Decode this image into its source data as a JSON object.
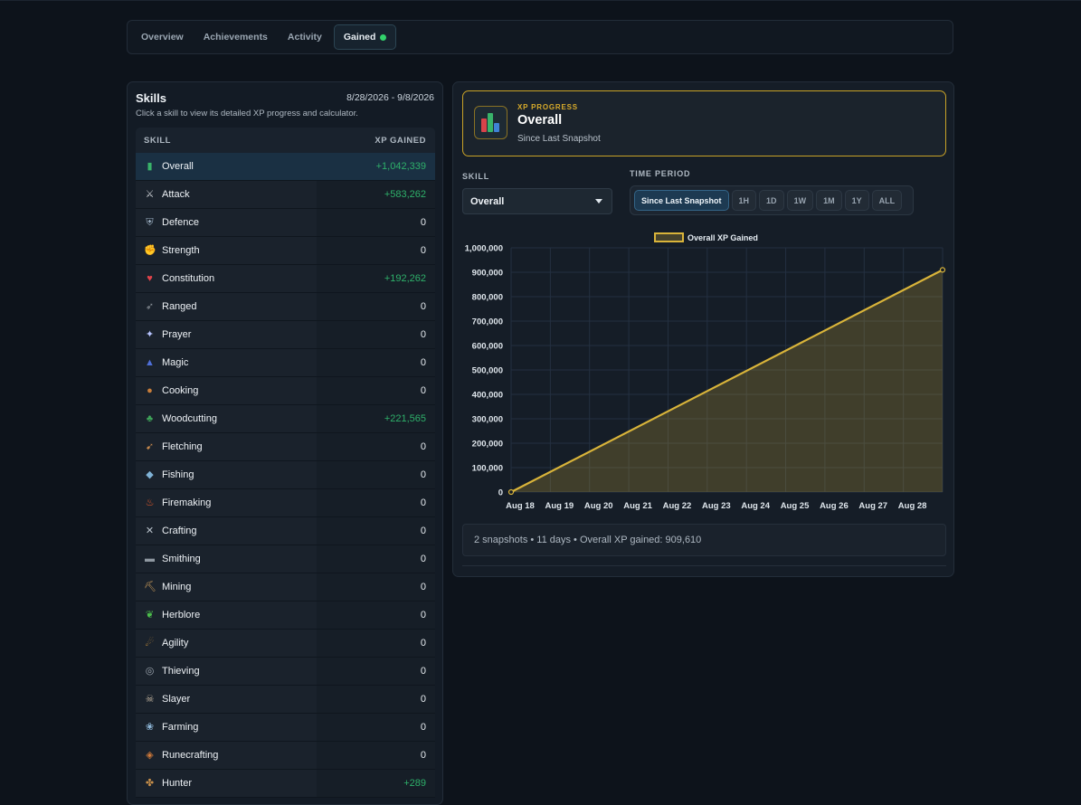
{
  "tabs": [
    {
      "label": "Overview"
    },
    {
      "label": "Achievements"
    },
    {
      "label": "Activity"
    },
    {
      "label": "Gained",
      "status_color": "#32d26b"
    }
  ],
  "skills_panel": {
    "title": "Skills",
    "date_range": "8/28/2026 - 9/8/2026",
    "subtitle": "Click a skill to view its detailed XP progress and calculator.",
    "col_skill": "SKILL",
    "col_xp": "XP GAINED",
    "rows": [
      {
        "name": "Overall",
        "xp": "+1,042,339",
        "icon": "bar-chart-icon"
      },
      {
        "name": "Attack",
        "xp": "+583,262",
        "icon": "sword-icon"
      },
      {
        "name": "Defence",
        "xp": "0",
        "icon": "shield-icon"
      },
      {
        "name": "Strength",
        "xp": "0",
        "icon": "fist-icon"
      },
      {
        "name": "Constitution",
        "xp": "+192,262",
        "icon": "heart-icon"
      },
      {
        "name": "Ranged",
        "xp": "0",
        "icon": "bow-icon"
      },
      {
        "name": "Prayer",
        "xp": "0",
        "icon": "star-icon"
      },
      {
        "name": "Magic",
        "xp": "0",
        "icon": "wizard-hat-icon"
      },
      {
        "name": "Cooking",
        "xp": "0",
        "icon": "pot-icon"
      },
      {
        "name": "Woodcutting",
        "xp": "+221,565",
        "icon": "tree-icon"
      },
      {
        "name": "Fletching",
        "xp": "0",
        "icon": "arrow-icon"
      },
      {
        "name": "Fishing",
        "xp": "0",
        "icon": "fish-icon"
      },
      {
        "name": "Firemaking",
        "xp": "0",
        "icon": "fire-icon"
      },
      {
        "name": "Crafting",
        "xp": "0",
        "icon": "tools-icon"
      },
      {
        "name": "Smithing",
        "xp": "0",
        "icon": "anvil-icon"
      },
      {
        "name": "Mining",
        "xp": "0",
        "icon": "pickaxe-icon"
      },
      {
        "name": "Herblore",
        "xp": "0",
        "icon": "herb-icon"
      },
      {
        "name": "Agility",
        "xp": "0",
        "icon": "runner-icon"
      },
      {
        "name": "Thieving",
        "xp": "0",
        "icon": "mask-icon"
      },
      {
        "name": "Slayer",
        "xp": "0",
        "icon": "skull-icon"
      },
      {
        "name": "Farming",
        "xp": "0",
        "icon": "seed-icon"
      },
      {
        "name": "Runecrafting",
        "xp": "0",
        "icon": "rune-icon"
      },
      {
        "name": "Hunter",
        "xp": "+289",
        "icon": "paw-icon"
      }
    ]
  },
  "xp_card": {
    "kicker": "XP PROGRESS",
    "title": "Overall",
    "subtitle": "Since Last Snapshot",
    "accent": "#c9a227"
  },
  "controls": {
    "skill_label": "SKILL",
    "skill_value": "Overall",
    "period_label": "TIME PERIOD",
    "periods": [
      "Since Last Snapshot",
      "1H",
      "1D",
      "1W",
      "1M",
      "1Y",
      "ALL"
    ],
    "active_period": "Since Last Snapshot"
  },
  "chart_data": {
    "type": "area",
    "series": [
      {
        "name": "Overall XP Gained",
        "x": [
          "Aug 18",
          "Aug 29"
        ],
        "values": [
          0,
          909610
        ]
      }
    ],
    "x_ticks": [
      "Aug 18",
      "Aug 19",
      "Aug 20",
      "Aug 21",
      "Aug 22",
      "Aug 23",
      "Aug 24",
      "Aug 25",
      "Aug 26",
      "Aug 27",
      "Aug 28"
    ],
    "y_ticks": [
      "0",
      "100,000",
      "200,000",
      "300,000",
      "400,000",
      "500,000",
      "600,000",
      "700,000",
      "800,000",
      "900,000",
      "1,000,000"
    ],
    "ylim": [
      0,
      1000000
    ],
    "legend": "top-center",
    "grid": true,
    "line_color": "#d9b43a"
  },
  "summary": "2 snapshots • 11 days • Overall XP gained: 909,610"
}
